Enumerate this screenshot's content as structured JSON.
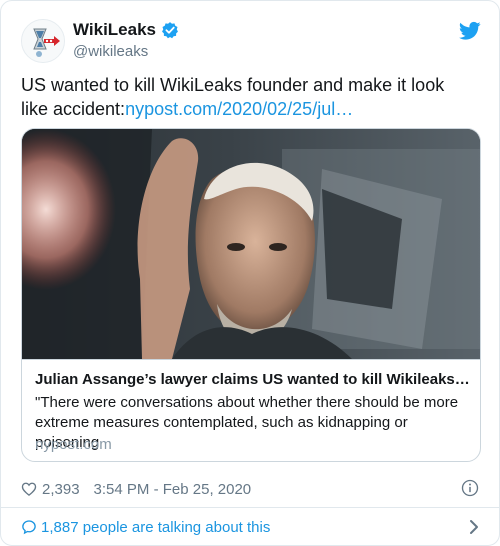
{
  "account": {
    "display_name": "WikiLeaks",
    "handle": "@wikileaks",
    "verified": true,
    "avatar_icon": "hourglass-logo-icon"
  },
  "tweet": {
    "text": "US wanted to kill WikiLeaks founder and make it look like accident:",
    "link_text": "nypost.com/2020/02/25/jul…"
  },
  "link_card": {
    "image_icon": "photo-thumbnail",
    "title": "Julian Assange’s lawyer claims US wanted to kill Wikileaks fo…",
    "description": "\"There were conversations about whether there should be more extreme measures contemplated, such as kidnapping or poisoning",
    "domain": "nypost.com"
  },
  "meta": {
    "like_count": "2,393",
    "timestamp": "3:54 PM - Feb 25, 2020"
  },
  "conversation": {
    "label": "1,887 people are talking about this"
  },
  "colors": {
    "accent": "#1da1f2",
    "link": "#1b95e0",
    "text": "#14171a",
    "muted": "#657786",
    "border": "#e1e8ed"
  }
}
